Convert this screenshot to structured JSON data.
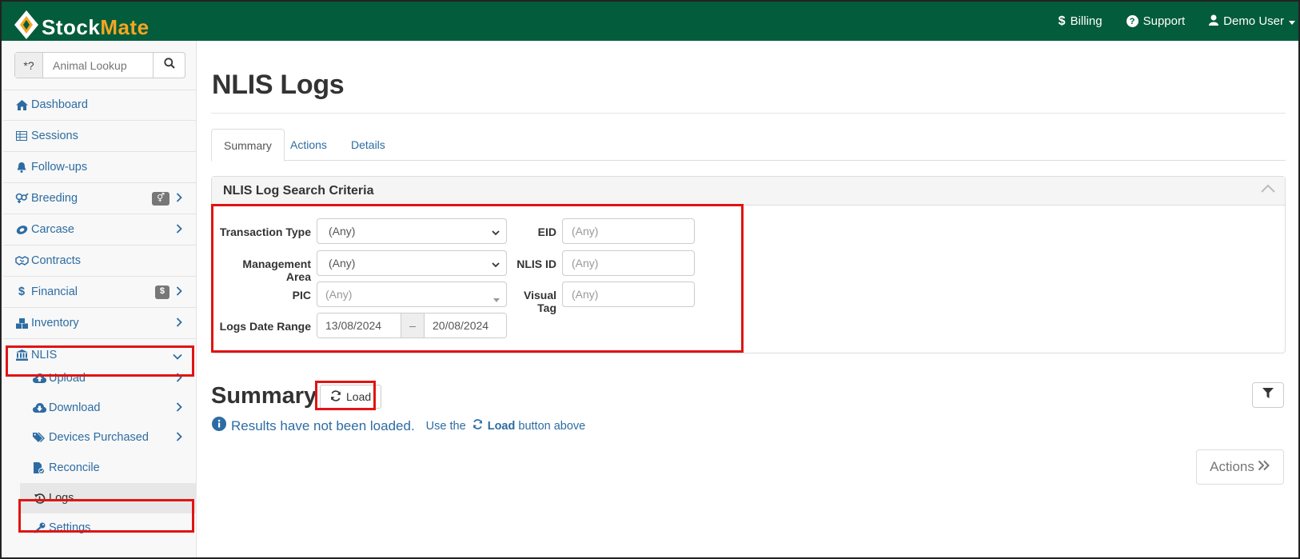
{
  "brand": {
    "part1": "Stock",
    "part2": "Mate"
  },
  "topnav": {
    "billing": "Billing",
    "support": "Support",
    "user": "Demo User"
  },
  "lookup": {
    "prefix": "*?",
    "placeholder": "Animal Lookup"
  },
  "sidebar": {
    "items": [
      {
        "label": "Dashboard"
      },
      {
        "label": "Sessions"
      },
      {
        "label": "Follow-ups"
      },
      {
        "label": "Breeding"
      },
      {
        "label": "Carcase"
      },
      {
        "label": "Contracts"
      },
      {
        "label": "Financial",
        "badge": "$"
      },
      {
        "label": "Inventory"
      },
      {
        "label": "NLIS"
      }
    ],
    "subitems": [
      {
        "label": "Upload"
      },
      {
        "label": "Download"
      },
      {
        "label": "Devices Purchased"
      },
      {
        "label": "Reconcile"
      },
      {
        "label": "Logs"
      },
      {
        "label": "Settings"
      }
    ]
  },
  "page": {
    "title": "NLIS Logs"
  },
  "tabs": [
    {
      "label": "Summary"
    },
    {
      "label": "Actions"
    },
    {
      "label": "Details"
    }
  ],
  "panel": {
    "title": "NLIS Log Search Criteria",
    "fields": {
      "transaction_type": {
        "label": "Transaction Type",
        "value": "(Any)"
      },
      "management_area": {
        "label": "Management Area",
        "value": "(Any)"
      },
      "pic": {
        "label": "PIC",
        "value": "(Any)"
      },
      "date_range": {
        "label": "Logs Date Range",
        "from": "13/08/2024",
        "separator": "–",
        "to": "20/08/2024"
      },
      "eid": {
        "label": "EID",
        "placeholder": "(Any)"
      },
      "nlis_id": {
        "label": "NLIS ID",
        "placeholder": "(Any)"
      },
      "visual_tag": {
        "label": "Visual Tag",
        "placeholder": "(Any)"
      }
    }
  },
  "summary": {
    "title": "Summary",
    "load_label": "Load",
    "message": "Results have not been loaded.",
    "hint_prefix": "Use the",
    "hint_button": "Load",
    "hint_suffix": "button above",
    "actions_label": "Actions"
  },
  "colors": {
    "topbar": "#035c3b",
    "brand_accent": "#f4a622",
    "link": "#2d6ca2",
    "highlight": "#e01414"
  }
}
